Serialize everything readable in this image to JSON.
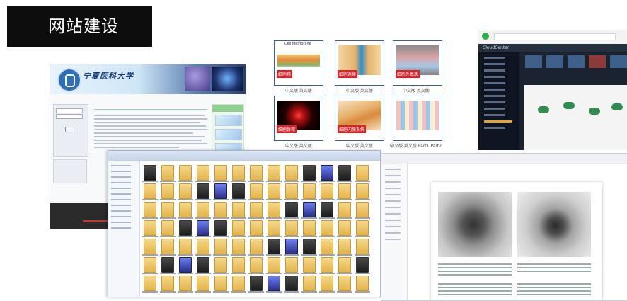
{
  "slide": {
    "title": "网站建设"
  },
  "website": {
    "school_name": "宁夏医科大学"
  },
  "thumbnails": [
    {
      "title": "Cell Membrane",
      "tag": "细胞膜",
      "caption": "中文版  英文版"
    },
    {
      "title": "",
      "tag": "细胞连接",
      "caption": "中文版  英文版"
    },
    {
      "title": "",
      "tag": "细胞外基质",
      "caption": "中文版  英文版"
    },
    {
      "title": "",
      "tag": "细胞骨架",
      "caption": "中文版  英文版"
    },
    {
      "title": "",
      "tag": "细胞内膜系统",
      "caption": "中文版  英文版"
    },
    {
      "title": "",
      "tag": "",
      "caption": "中文版  英文版 Part1 Part2"
    }
  ],
  "browser": {
    "app_name": "CloudCenter"
  },
  "explorer": {},
  "pdf": {},
  "colors": {
    "title_bg": "#0d0d0d",
    "tag_red": "#d6242a",
    "thumb_border": "#3d5aa8"
  }
}
